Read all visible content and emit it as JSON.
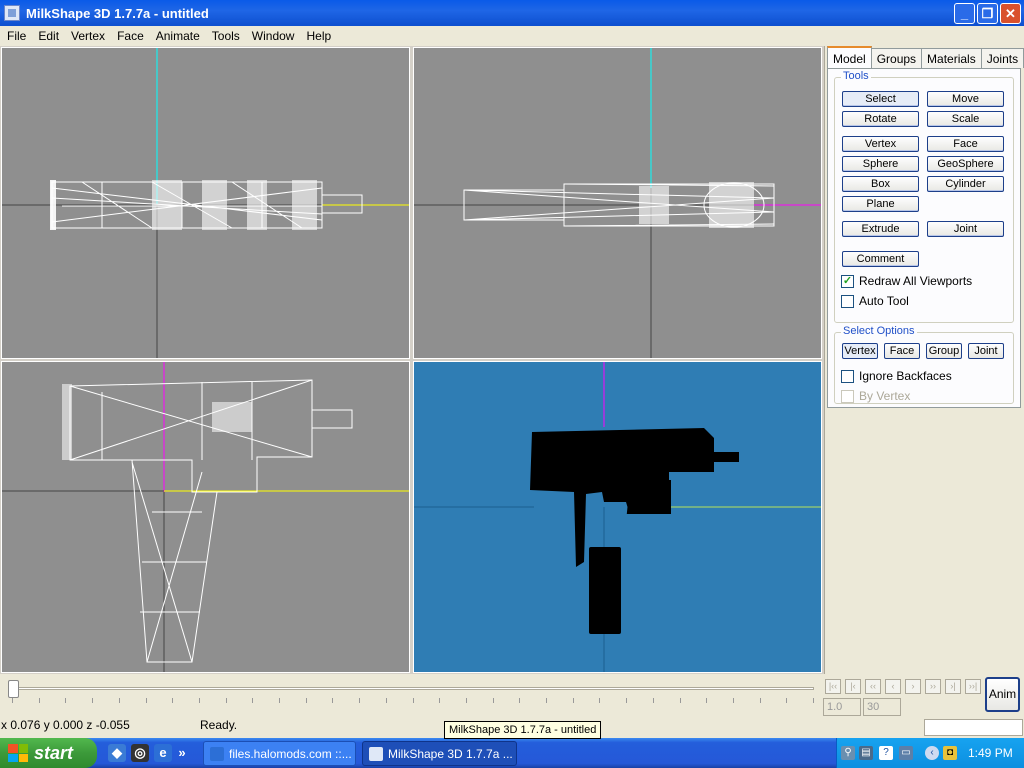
{
  "window": {
    "title": "MilkShape 3D 1.7.7a - untitled",
    "minimize_glyph": "_",
    "maximize_glyph": "❐",
    "close_glyph": "✕"
  },
  "menu": [
    "File",
    "Edit",
    "Vertex",
    "Face",
    "Animate",
    "Tools",
    "Window",
    "Help"
  ],
  "sidebar": {
    "tabs": [
      "Model",
      "Groups",
      "Materials",
      "Joints"
    ],
    "tools_legend": "Tools",
    "tool_buttons": {
      "select": "Select",
      "move": "Move",
      "rotate": "Rotate",
      "scale": "Scale",
      "vertex": "Vertex",
      "face": "Face",
      "sphere": "Sphere",
      "geosphere": "GeoSphere",
      "box": "Box",
      "cylinder": "Cylinder",
      "plane": "Plane",
      "extrude": "Extrude",
      "joint": "Joint",
      "comment": "Comment"
    },
    "redraw_all_viewports": "Redraw All Viewports",
    "redraw_checked_glyph": "✓",
    "auto_tool": "Auto Tool",
    "select_options_legend": "Select Options",
    "select_buttons": {
      "vertex": "Vertex",
      "face": "Face",
      "group": "Group",
      "joint": "Joint"
    },
    "ignore_backfaces": "Ignore Backfaces",
    "by_vertex": "By Vertex"
  },
  "animation": {
    "nav_glyphs": [
      "|‹‹",
      "|‹",
      "‹‹",
      "‹",
      "›",
      "››",
      "›|",
      "››|"
    ],
    "frame_start": "1.0",
    "frame_end": "30",
    "anim_button": "Anim"
  },
  "status": {
    "coords": "x 0.076 y 0.000 z -0.055",
    "message": "Ready.",
    "tooltip": "MilkShape 3D 1.7.7a - untitled"
  },
  "taskbar": {
    "start": "start",
    "quick_launch_overflow": "»",
    "tasks": [
      "files.halomods.com ::...",
      "MilkShape 3D 1.7.7a ..."
    ],
    "clock": "1:49 PM"
  },
  "colors": {
    "viewport_gray": "#8f8f8f",
    "viewport_3d_blue": "#2f7db4",
    "axis_cyan": "#00ffff",
    "axis_yellow": "#ffff00",
    "axis_magenta": "#ff00ff",
    "selection_orange": "#e68b2c"
  }
}
